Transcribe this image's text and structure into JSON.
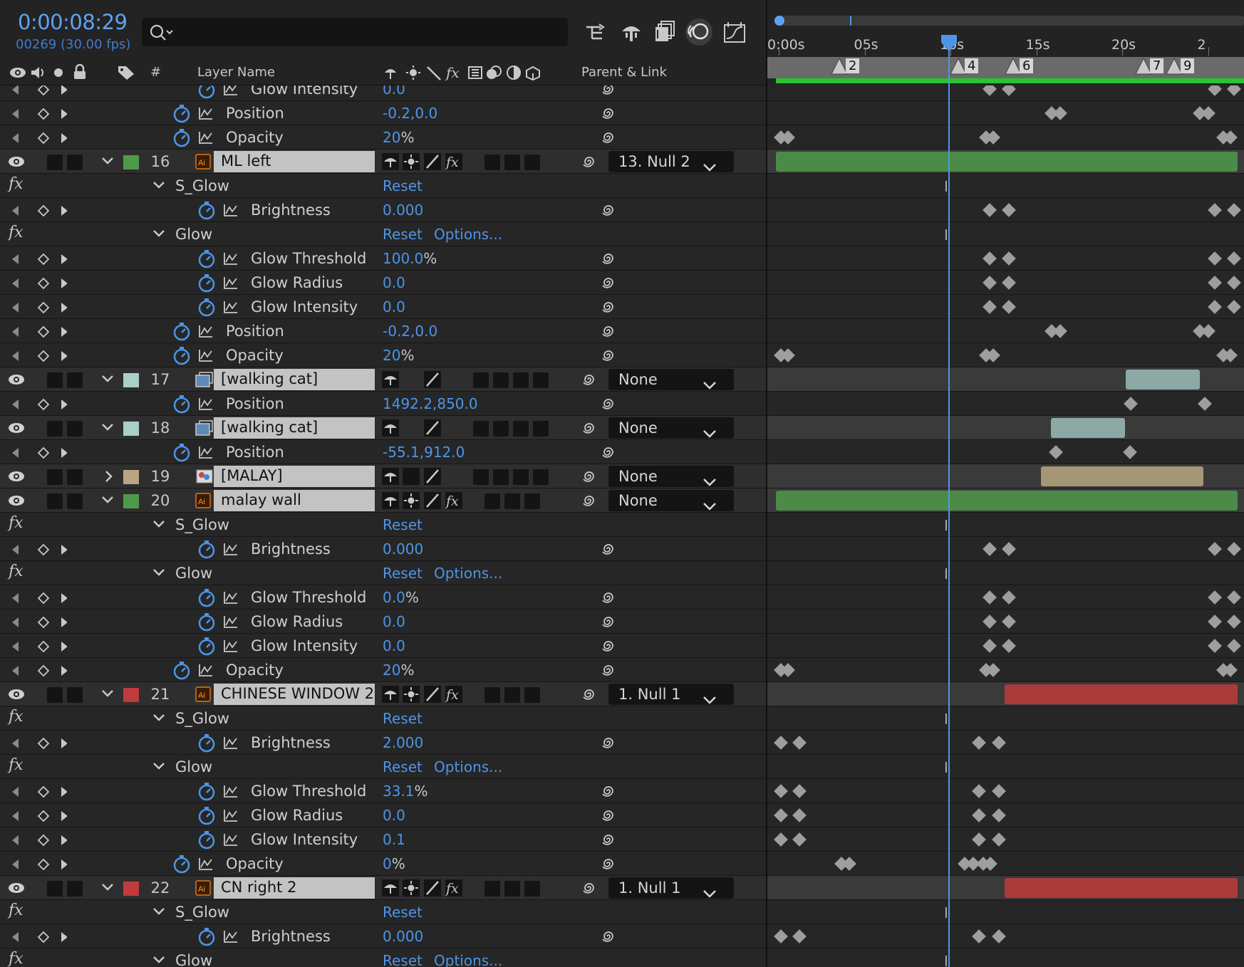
{
  "header": {
    "timecode": "0:00:08:29",
    "frame_info": "00269 (30.00 fps)",
    "search_placeholder": ""
  },
  "toolbar": {
    "icons": [
      "composition-flowchart-icon",
      "draft-3d-icon",
      "frame-blending-icon",
      "motion-blur-icon",
      "graph-editor-icon"
    ]
  },
  "columns": {
    "hash": "#",
    "layer_name": "Layer Name",
    "parent_link": "Parent & Link"
  },
  "ruler": {
    "ticks": [
      "0:00s",
      "05s",
      "10s",
      "15s",
      "20s",
      "2"
    ],
    "markers": [
      "2",
      "4",
      "6",
      "7",
      "9"
    ]
  },
  "colors": {
    "accent": "#4d95e8",
    "green_label": "#4f9a4a",
    "aqua_label": "#a9cfc9",
    "tan_label": "#b8a781",
    "red_label": "#c03b3b"
  },
  "rows": [
    {
      "kind": "prop",
      "indent": 2,
      "name": "Glow Intensity",
      "value": "0.0"
    },
    {
      "kind": "prop",
      "indent": 1,
      "name": "Position",
      "value": "-0.2,0.0"
    },
    {
      "kind": "prop",
      "indent": 1,
      "name": "Opacity",
      "value": "20",
      "unit": "%"
    },
    {
      "kind": "layer",
      "num": "16",
      "name": "ML left",
      "label": "green",
      "type": "ai",
      "parent": "13. Null 2",
      "fx": true
    },
    {
      "kind": "effect",
      "name": "S_Glow",
      "reset": "Reset"
    },
    {
      "kind": "prop",
      "indent": 2,
      "name": "Brightness",
      "value": "0.000"
    },
    {
      "kind": "effect",
      "name": "Glow",
      "reset": "Reset",
      "options": "Options..."
    },
    {
      "kind": "prop",
      "indent": 2,
      "name": "Glow Threshold",
      "value": "100.0",
      "unit": "%"
    },
    {
      "kind": "prop",
      "indent": 2,
      "name": "Glow Radius",
      "value": "0.0"
    },
    {
      "kind": "prop",
      "indent": 2,
      "name": "Glow Intensity",
      "value": "0.0"
    },
    {
      "kind": "prop",
      "indent": 1,
      "name": "Position",
      "value": "-0.2,0.0"
    },
    {
      "kind": "prop",
      "indent": 1,
      "name": "Opacity",
      "value": "20",
      "unit": "%"
    },
    {
      "kind": "layer",
      "num": "17",
      "name": "[walking cat]",
      "label": "aqua",
      "type": "footage",
      "parent": "None",
      "fx": false
    },
    {
      "kind": "prop",
      "indent": 1,
      "name": "Position",
      "value": "1492.2,850.0"
    },
    {
      "kind": "layer",
      "num": "18",
      "name": "[walking cat]",
      "label": "aqua",
      "type": "footage",
      "parent": "None",
      "fx": false
    },
    {
      "kind": "prop",
      "indent": 1,
      "name": "Position",
      "value": "-55.1,912.0"
    },
    {
      "kind": "layer",
      "num": "19",
      "name": "[MALAY]",
      "label": "tan",
      "type": "precomp",
      "parent": "None",
      "fx": false,
      "collapsed": true
    },
    {
      "kind": "layer",
      "num": "20",
      "name": "malay wall",
      "label": "green",
      "type": "ai",
      "parent": "None",
      "fx": true
    },
    {
      "kind": "effect",
      "name": "S_Glow",
      "reset": "Reset"
    },
    {
      "kind": "prop",
      "indent": 2,
      "name": "Brightness",
      "value": "0.000"
    },
    {
      "kind": "effect",
      "name": "Glow",
      "reset": "Reset",
      "options": "Options..."
    },
    {
      "kind": "prop",
      "indent": 2,
      "name": "Glow Threshold",
      "value": "0.0",
      "unit": "%"
    },
    {
      "kind": "prop",
      "indent": 2,
      "name": "Glow Radius",
      "value": "0.0"
    },
    {
      "kind": "prop",
      "indent": 2,
      "name": "Glow Intensity",
      "value": "0.0"
    },
    {
      "kind": "prop",
      "indent": 1,
      "name": "Opacity",
      "value": "20",
      "unit": "%"
    },
    {
      "kind": "layer",
      "num": "21",
      "name": "CHINESE WINDOW 2",
      "label": "red",
      "type": "ai",
      "parent": "1. Null 1",
      "fx": true
    },
    {
      "kind": "effect",
      "name": "S_Glow",
      "reset": "Reset"
    },
    {
      "kind": "prop",
      "indent": 2,
      "name": "Brightness",
      "value": "2.000"
    },
    {
      "kind": "effect",
      "name": "Glow",
      "reset": "Reset",
      "options": "Options..."
    },
    {
      "kind": "prop",
      "indent": 2,
      "name": "Glow Threshold",
      "value": "33.1",
      "unit": "%"
    },
    {
      "kind": "prop",
      "indent": 2,
      "name": "Glow Radius",
      "value": "0.0"
    },
    {
      "kind": "prop",
      "indent": 2,
      "name": "Glow Intensity",
      "value": "0.1"
    },
    {
      "kind": "prop",
      "indent": 1,
      "name": "Opacity",
      "value": "0",
      "unit": "%"
    },
    {
      "kind": "layer",
      "num": "22",
      "name": "CN right 2",
      "label": "red",
      "type": "ai",
      "parent": "1. Null 1",
      "fx": true
    },
    {
      "kind": "effect",
      "name": "S_Glow",
      "reset": "Reset"
    },
    {
      "kind": "prop",
      "indent": 2,
      "name": "Brightness",
      "value": "0.000"
    },
    {
      "kind": "effect",
      "name": "Glow",
      "reset": "Reset",
      "options": "Options..."
    }
  ]
}
